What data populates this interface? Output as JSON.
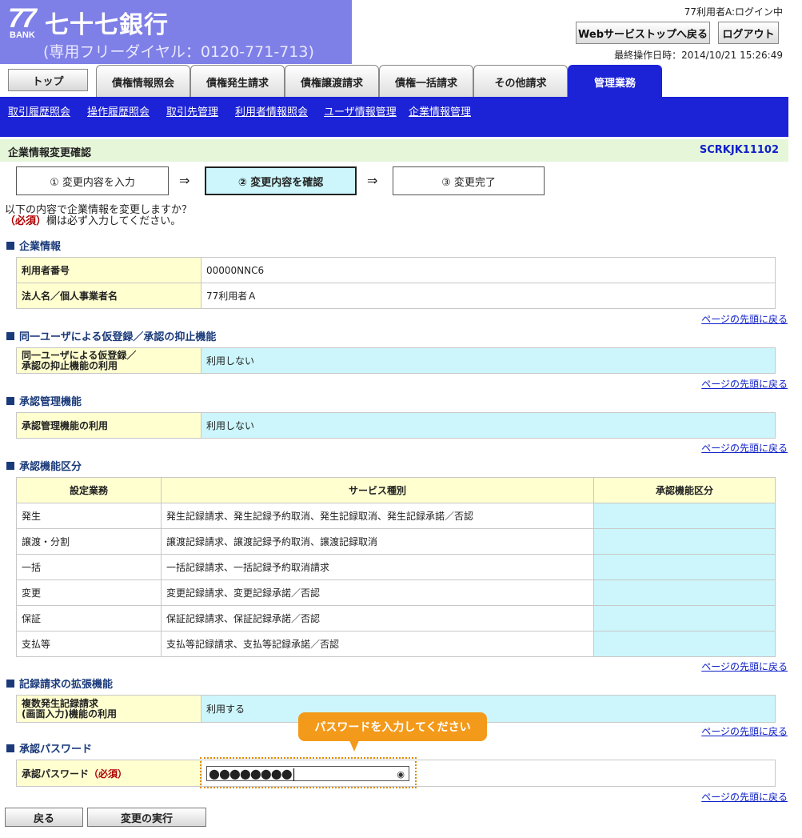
{
  "bank": {
    "logo_number": "77",
    "logo_bank": "BANK",
    "name": "七十七銀行",
    "tel": "(専用フリーダイヤル：0120-771-713)"
  },
  "header": {
    "login_status": "77利用者A:ログイン中",
    "web_top_button": "Webサービストップへ戻る",
    "logout_button": "ログアウト",
    "last_operation": "最終操作日時：2014/10/21 15:26:49"
  },
  "tabs": {
    "top": "トップ",
    "items": [
      "債権情報照会",
      "債権発生請求",
      "債権譲渡請求",
      "債権一括請求",
      "その他請求",
      "管理業務"
    ],
    "active_index": 5
  },
  "subnav": [
    "取引履歴照会",
    "操作履歴照会",
    "取引先管理",
    "利用者情報照会",
    "ユーザ情報管理",
    "企業情報管理"
  ],
  "page": {
    "title": "企業情報変更確認",
    "screen_id": "SCRKJK11102"
  },
  "steps": [
    "① 変更内容を入力",
    "② 変更内容を確認",
    "③ 変更完了"
  ],
  "step_arrow": "⇒",
  "intro": {
    "line1": "以下の内容で企業情報を変更しますか？",
    "required_mark": "（必須）",
    "line2": "欄は必ず入力してください。"
  },
  "back_to_top": "ページの先頭に戻る",
  "sections": {
    "company": {
      "title": "企業情報",
      "rows": [
        {
          "label": "利用者番号",
          "value": "00000NNC6"
        },
        {
          "label": "法人名／個人事業者名",
          "value": "77利用者Ａ"
        }
      ]
    },
    "suppress": {
      "title": "同一ユーザによる仮登録／承認の抑止機能",
      "label_line1": "同一ユーザによる仮登録／",
      "label_line2": "承認の抑止機能の利用",
      "value": "利用しない"
    },
    "approval": {
      "title": "承認管理機能",
      "label": "承認管理機能の利用",
      "value": "利用しない"
    },
    "approval_class": {
      "title": "承認機能区分",
      "headers": [
        "設定業務",
        "サービス種別",
        "承認機能区分"
      ],
      "rows": [
        {
          "task": "発生",
          "service": "発生記録請求、発生記録予約取消、発生記録取消、発生記録承諾／否認",
          "class": ""
        },
        {
          "task": "譲渡・分割",
          "service": "譲渡記録請求、譲渡記録予約取消、譲渡記録取消",
          "class": ""
        },
        {
          "task": "一括",
          "service": "一括記録請求、一括記録予約取消請求",
          "class": ""
        },
        {
          "task": "変更",
          "service": "変更記録請求、変更記録承諾／否認",
          "class": ""
        },
        {
          "task": "保証",
          "service": "保証記録請求、保証記録承諾／否認",
          "class": ""
        },
        {
          "task": "支払等",
          "service": "支払等記録請求、支払等記録承諾／否認",
          "class": ""
        }
      ]
    },
    "extension": {
      "title": "記録請求の拡張機能",
      "label_line1": "複数発生記録請求",
      "label_line2": "(画面入力)機能の利用",
      "value": "利用する"
    },
    "password": {
      "title": "承認パスワード",
      "label": "承認パスワード",
      "required": "（必須）",
      "masked_value": "●●●●●●●●|",
      "hint": "パスワードを入力してください"
    }
  },
  "buttons": {
    "back": "戻る",
    "execute": "変更の実行"
  }
}
